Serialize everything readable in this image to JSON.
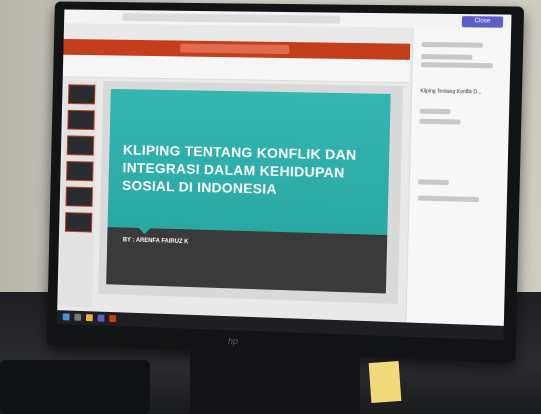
{
  "slide": {
    "title": "KLIPING TENTANG KONFLIK DAN INTEGRASI DALAM KEHIDUPAN SOSIAL DI INDONESIA",
    "author": "BY : ARENFA FAIRUZ K"
  },
  "app": {
    "close_label": "Close",
    "side_file_title": "Kliping Tentang Konflik D..."
  },
  "monitor": {
    "brand_logo": "hp"
  },
  "colors": {
    "slide_teal": "#2aa8a4",
    "ppt_red": "#c43e1c",
    "teams_purple": "#5b5fc7"
  }
}
